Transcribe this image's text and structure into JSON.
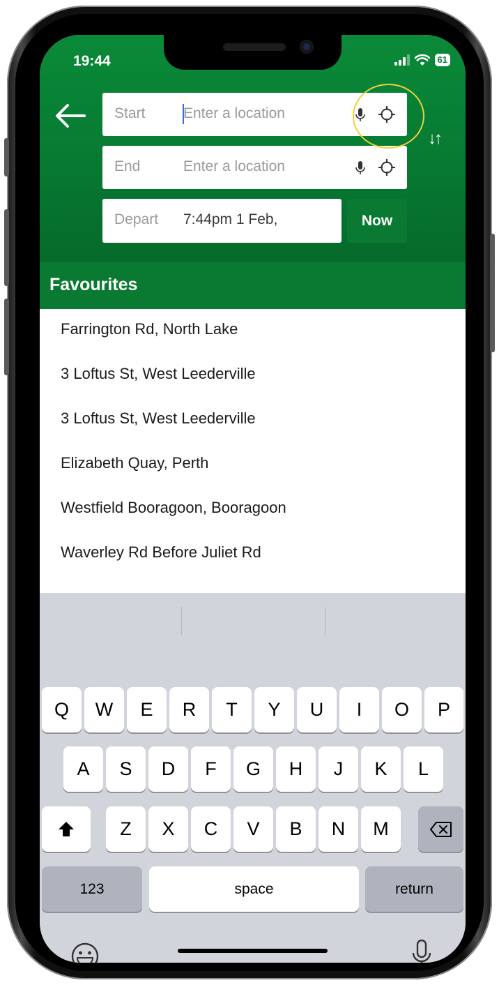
{
  "status": {
    "time": "19:44",
    "battery": "61"
  },
  "trip": {
    "start_label": "Start",
    "start_placeholder": "Enter a location",
    "end_label": "End",
    "end_placeholder": "Enter a location",
    "depart_label": "Depart",
    "depart_value": "7:44pm 1 Feb,",
    "now_label": "Now"
  },
  "favourites": {
    "title": "Favourites",
    "items": [
      "Farrington Rd, North Lake",
      "3 Loftus St, West Leederville",
      "3 Loftus St, West Leederville",
      "Elizabeth Quay, Perth",
      "Westfield Booragoon, Booragoon",
      "Waverley Rd Before Juliet Rd"
    ]
  },
  "keyboard": {
    "row1": [
      "Q",
      "W",
      "E",
      "R",
      "T",
      "Y",
      "U",
      "I",
      "O",
      "P"
    ],
    "row2": [
      "A",
      "S",
      "D",
      "F",
      "G",
      "H",
      "J",
      "K",
      "L"
    ],
    "row3": [
      "Z",
      "X",
      "C",
      "V",
      "B",
      "N",
      "M"
    ],
    "numbers_label": "123",
    "space_label": "space",
    "return_label": "return"
  },
  "colors": {
    "brand_green": "#0a7a33",
    "highlight_ring": "#f0d03a",
    "cursor": "#2f6df0"
  }
}
